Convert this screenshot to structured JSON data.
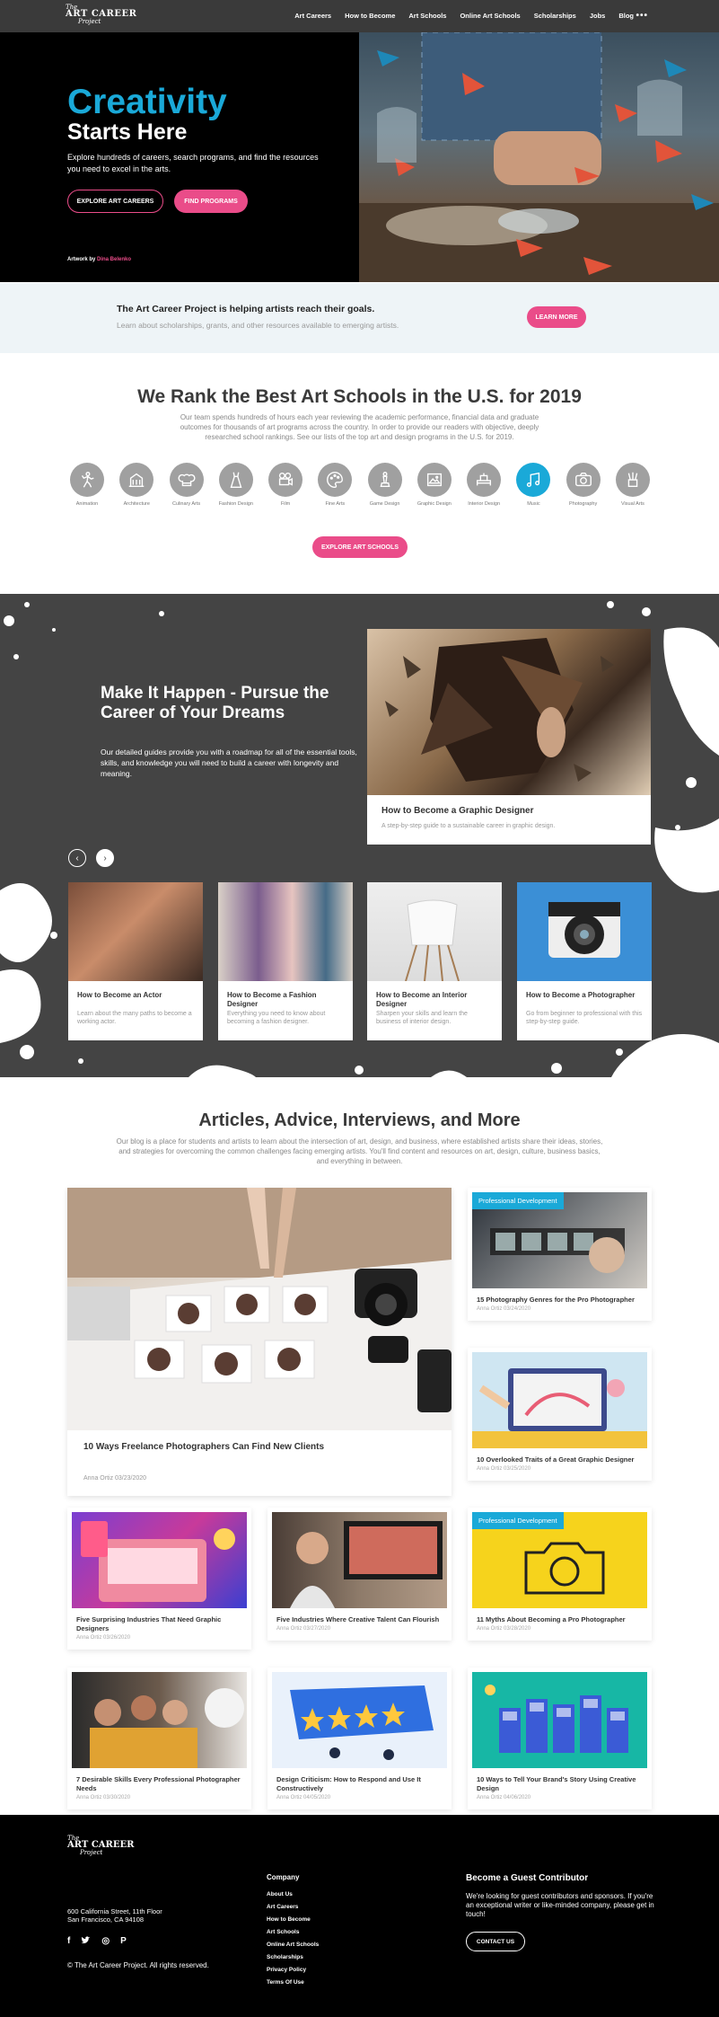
{
  "header": {
    "logo": {
      "line1": "The",
      "line2": "ART CAREER",
      "line3": "Project"
    },
    "nav": [
      "Art Careers",
      "How to Become",
      "Art Schools",
      "Online Art Schools",
      "Scholarships",
      "Jobs",
      "Blog"
    ],
    "more": "•••"
  },
  "hero": {
    "title1": "Creativity",
    "title2": "Starts Here",
    "description": "Explore hundreds of careers, search programs, and find the resources you need to excel in the arts.",
    "btn_careers": "EXPLORE ART CAREERS",
    "btn_programs": "FIND PROGRAMS",
    "credit_prefix": "Artwork by",
    "credit_name": "Dina Belenko"
  },
  "help": {
    "title": "The Art Career Project is helping artists reach their goals.",
    "subtitle": "Learn about scholarships, grants, and other resources available to emerging artists.",
    "button": "LEARN MORE"
  },
  "rank": {
    "title": "We Rank the Best Art Schools in the U.S. for 2019",
    "description": "Our team spends hundreds of hours each year reviewing the academic performance, financial data and graduate outcomes for thousands of art programs across the country. In order to provide our readers with objective, deeply researched school rankings. See our lists of the top art and design programs in the U.S. for 2019.",
    "categories": [
      "Animation",
      "Architecture",
      "Culinary Arts",
      "Fashion Design",
      "Film",
      "Fine Arts",
      "Game Design",
      "Graphic Design",
      "Interior Design",
      "Music",
      "Photography",
      "Visual Arts"
    ],
    "active_category": "Music",
    "button": "EXPLORE ART SCHOOLS"
  },
  "career": {
    "title": "Make It Happen - Pursue the Career of Your Dreams",
    "description": "Our detailed guides provide you with a roadmap for all of the essential tools, skills, and knowledge you will need to build a career with longevity and meaning.",
    "featured": {
      "title": "How to Become a Graphic Designer",
      "subtitle": "A step-by-step guide to a sustainable career in graphic design."
    },
    "cards": [
      {
        "title": "How to Become an Actor",
        "subtitle": "Learn about the many paths to become a working actor."
      },
      {
        "title": "How to Become a Fashion Designer",
        "subtitle": "Everything you need to know about becoming a fashion designer."
      },
      {
        "title": "How to Become an Interior Designer",
        "subtitle": "Sharpen your skills and learn the business of interior design."
      },
      {
        "title": "How to Become a Photographer",
        "subtitle": "Go from beginner to professional with this step-by-step guide."
      }
    ]
  },
  "articles": {
    "title": "Articles, Advice, Interviews, and More",
    "description": "Our blog is a place for students and artists to learn about the intersection of art, design, and business, where established artists share their ideas, stories, and strategies for overcoming the common challenges facing emerging artists. You'll find content and resources on art, design, culture, business basics, and everything in between.",
    "badge": "Professional Development",
    "big": {
      "title": "10 Ways Freelance Photographers Can Find New Clients",
      "meta": "Anna Ortiz 03/23/2020"
    },
    "items": [
      {
        "title": "15 Photography Genres for the Pro Photographer",
        "meta": "Anna Ortiz 03/24/2020"
      },
      {
        "title": "10 Overlooked Traits of a Great Graphic Designer",
        "meta": "Anna Ortiz 03/25/2020"
      },
      {
        "title": "Five Surprising Industries That Need Graphic Designers",
        "meta": "Anna Ortiz 03/26/2020"
      },
      {
        "title": "Five Industries Where Creative Talent Can Flourish",
        "meta": "Anna Ortiz 03/27/2020"
      },
      {
        "title": "11 Myths About Becoming a Pro Photographer",
        "meta": "Anna Ortiz 03/28/2020"
      },
      {
        "title": "7 Desirable Skills Every Professional Photographer Needs",
        "meta": "Anna Ortiz 03/30/2020"
      },
      {
        "title": "Design Criticism: How to Respond and Use It Constructively",
        "meta": "Anna Ortiz 04/05/2020"
      },
      {
        "title": "10 Ways to Tell Your Brand's Story Using Creative Design",
        "meta": "Anna Ortiz 04/06/2020"
      }
    ]
  },
  "footer": {
    "address1": "600 California Street, 11th Floor",
    "address2": "San Francisco, CA 94108",
    "social": [
      "f",
      "t",
      "◎",
      "P"
    ],
    "copyright": "© The Art Career Project. All rights reserved.",
    "company_heading": "Company",
    "links": [
      "About Us",
      "Art Careers",
      "How to Become",
      "Art Schools",
      "Online Art Schools",
      "Scholarships",
      "Privacy Policy",
      "Terms Of Use"
    ],
    "guest_heading": "Become a Guest Contributor",
    "guest_text": "We're looking for guest contributors and sponsors. If you're an exceptional writer or like-minded company, please get in touch!",
    "contact_button": "CONTACT US"
  },
  "colors": {
    "accent_blue": "#1aa9d8",
    "accent_pink": "#ea4c89",
    "dark": "#444444"
  }
}
